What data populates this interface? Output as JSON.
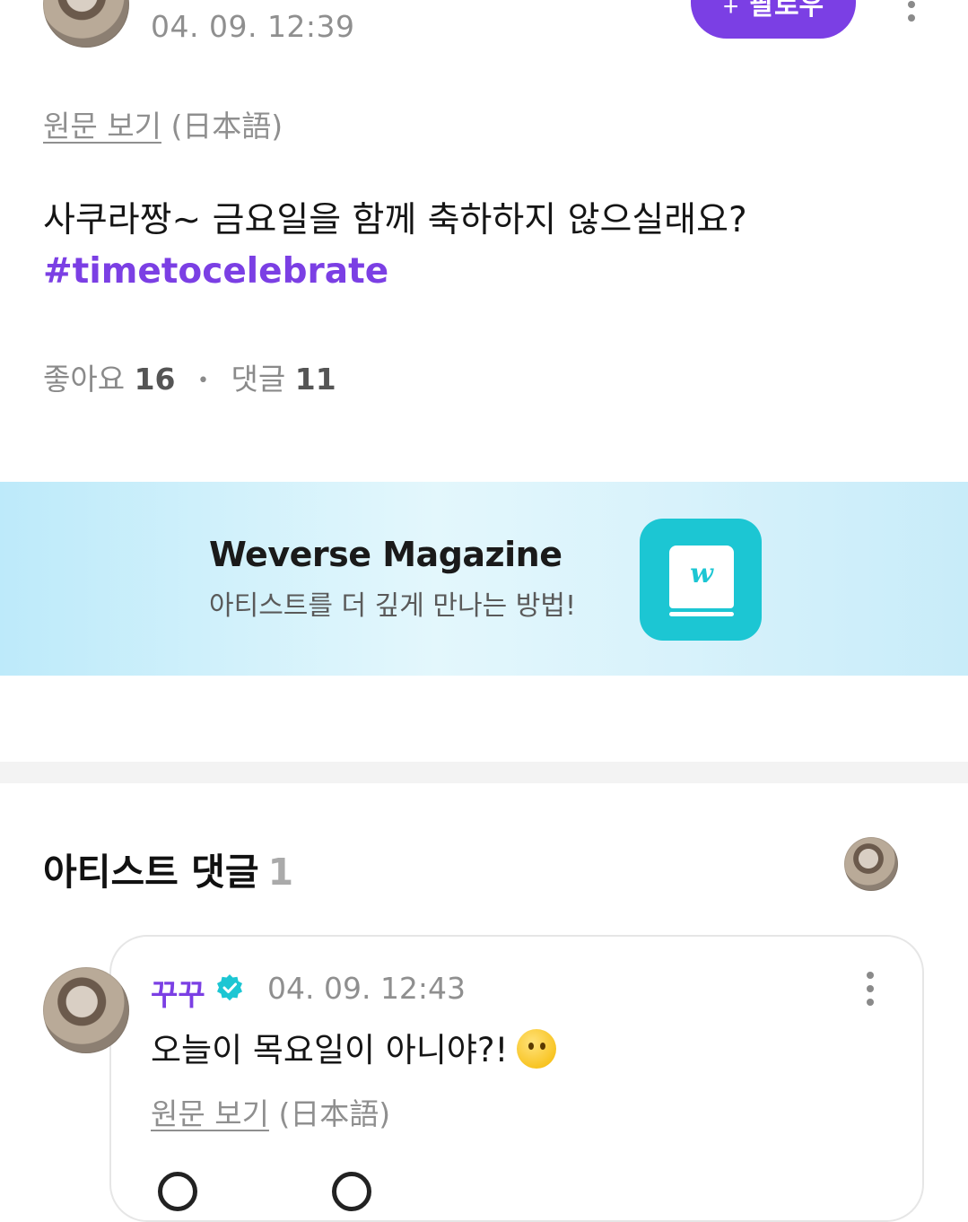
{
  "post": {
    "date": "04. 09. 12:39",
    "follow_label": "팔로우",
    "follow_plus": "+",
    "original_link": "원문 보기",
    "original_lang": "(日本語)",
    "text": "사쿠라짱~ 금요일을 함께 축하하지 않으실래요?",
    "hashtag": "#timetocelebrate",
    "likes_label": "좋아요",
    "likes_count": "16",
    "comments_label": "댓글",
    "comments_count": "11"
  },
  "banner": {
    "title": "Weverse Magazine",
    "subtitle": "아티스트를 더 깊게 만나는 방법!",
    "icon_letter": "w",
    "color": "#1cc6d3"
  },
  "artist_comments": {
    "title": "아티스트 댓글",
    "count": "1",
    "items": [
      {
        "author": "꾸꾸",
        "date": "04. 09. 12:43",
        "text": "오늘이 목요일이 아니야?!",
        "original_link": "원문 보기",
        "original_lang": "(日本語)"
      }
    ]
  },
  "colors": {
    "accent": "#7b3fe4",
    "verified": "#1cc6d3",
    "muted_text": "#8f8f8f"
  }
}
